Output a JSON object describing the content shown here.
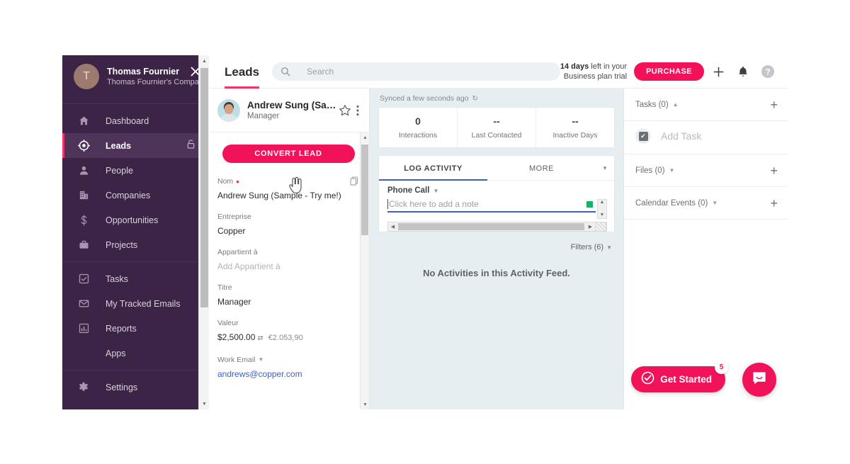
{
  "sidebar": {
    "user": {
      "initial": "T",
      "name": "Thomas Fournier",
      "org": "Thomas Fournier's Company"
    },
    "close_icon": "close-icon",
    "items": [
      {
        "label": "Dashboard",
        "icon": "home-icon",
        "active": false,
        "locked": false
      },
      {
        "label": "Leads",
        "icon": "target-icon",
        "active": true,
        "locked": true
      },
      {
        "label": "People",
        "icon": "person-icon",
        "active": false,
        "locked": false
      },
      {
        "label": "Companies",
        "icon": "building-icon",
        "active": false,
        "locked": false
      },
      {
        "label": "Opportunities",
        "icon": "dollar-icon",
        "active": false,
        "locked": false
      },
      {
        "label": "Projects",
        "icon": "briefcase-icon",
        "active": false,
        "locked": false
      },
      {
        "label": "Tasks",
        "icon": "checkbox-icon",
        "active": false,
        "locked": false
      },
      {
        "label": "My Tracked Emails",
        "icon": "envelope-icon",
        "active": false,
        "locked": false
      },
      {
        "label": "Reports",
        "icon": "bar-chart-icon",
        "active": false,
        "locked": false
      },
      {
        "label": "Apps",
        "icon": "",
        "active": false,
        "locked": false
      },
      {
        "label": "Settings",
        "icon": "gear-icon",
        "active": false,
        "locked": false
      }
    ]
  },
  "topbar": {
    "title": "Leads",
    "search_placeholder": "Search",
    "search_value": "",
    "trial_days": "14 days",
    "trial_rest": " left in your",
    "trial_line2": "Business plan trial",
    "purchase_label": "PURCHASE",
    "add_icon": "plus-icon",
    "bell_icon": "bell-icon",
    "help_icon": "help-icon"
  },
  "detail": {
    "name": "Andrew Sung (Sa…",
    "role": "Manager",
    "star_icon": "star-icon",
    "kebab_icon": "more-vertical-icon",
    "convert_label": "CONVERT LEAD",
    "copy_icon": "copy-icon",
    "fields": [
      {
        "key": "Nom",
        "required": true,
        "value": "Andrew Sung (Sample - Try me!)",
        "style": "text",
        "copy": true
      },
      {
        "key": "Entreprise",
        "required": false,
        "value": "Copper",
        "style": "text",
        "copy": false
      },
      {
        "key": "Appartient à",
        "required": false,
        "value": "Add Appartient à",
        "style": "muted",
        "copy": false
      },
      {
        "key": "Titre",
        "required": false,
        "value": "Manager",
        "style": "text",
        "copy": false
      },
      {
        "key": "Valeur",
        "required": false,
        "value": "$2,500.00",
        "converted": "€2.053,90",
        "style": "currency",
        "copy": false
      },
      {
        "key": "Work Email",
        "required": false,
        "dropdown": true,
        "value": "andrews@copper.com",
        "style": "link",
        "copy": false
      }
    ]
  },
  "feed": {
    "synced": "Synced a few seconds ago",
    "refresh_icon": "refresh-icon",
    "stats": [
      {
        "value": "0",
        "label": "Interactions"
      },
      {
        "value": "--",
        "label": "Last Contacted"
      },
      {
        "value": "--",
        "label": "Inactive Days"
      }
    ],
    "tabs": [
      {
        "label": "LOG ACTIVITY",
        "active": true
      },
      {
        "label": "MORE",
        "active": false
      }
    ],
    "tab_caret_icon": "chevron-down-icon",
    "log_type": "Phone Call",
    "note_placeholder": "Click here to add a note",
    "note_value": "",
    "filters_label": "Filters (6)",
    "empty_text": "No Activities in this Activity Feed."
  },
  "side": {
    "sections": [
      {
        "title": "Tasks (0)",
        "caret": "up",
        "plus": "plus-icon"
      },
      {
        "title": "Files (0)",
        "caret": "down",
        "plus": "plus-icon"
      },
      {
        "title": "Calendar Events (0)",
        "caret": "down",
        "plus": "plus-icon"
      }
    ],
    "add_task_label": "Add Task",
    "add_task_icon": "check-square-icon"
  },
  "widgets": {
    "get_started_label": "Get Started",
    "get_started_icon": "check-circle-icon",
    "get_started_badge": "5",
    "chat_icon": "chat-bubble-icon"
  },
  "colors": {
    "brand_pink": "#f2125a",
    "sidebar": "#3c2447",
    "accent_blue": "#3f5fc0",
    "feed_bg": "#e7eef1"
  }
}
